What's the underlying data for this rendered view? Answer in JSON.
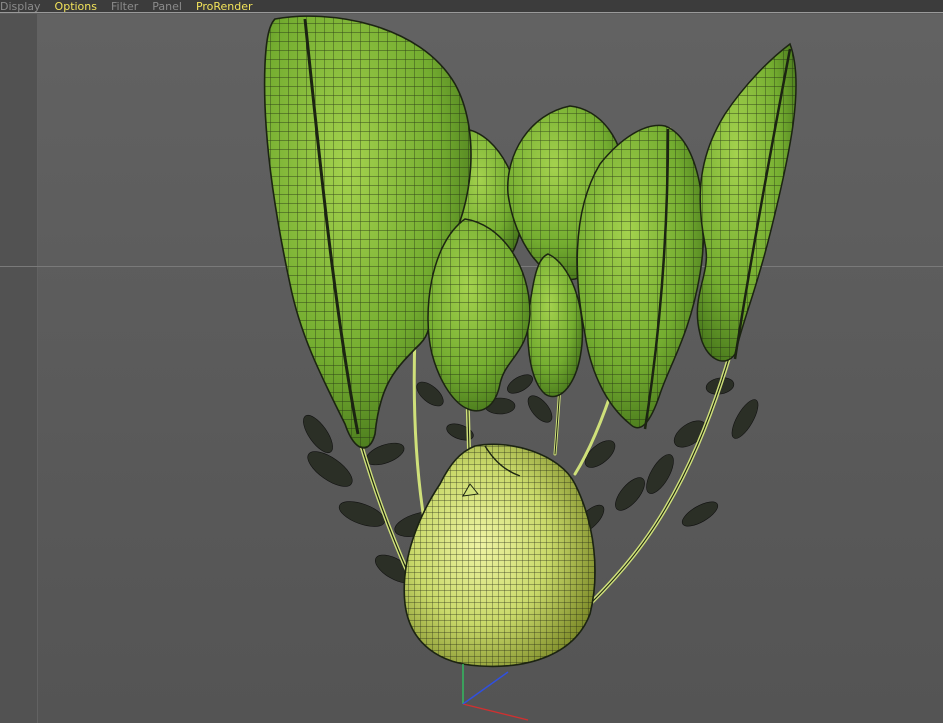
{
  "menu": {
    "items": [
      {
        "label": "Display",
        "state": "dim"
      },
      {
        "label": "Options",
        "state": "highlight"
      },
      {
        "label": "Filter",
        "state": "dim"
      },
      {
        "label": "Panel",
        "state": "dim"
      },
      {
        "label": "ProRender",
        "state": "highlight"
      }
    ]
  },
  "viewport": {
    "display_mode": "shaded-wireframe",
    "object": "kohlrabi-plant",
    "axis_colors": {
      "x": "#d03030",
      "y": "#30c060",
      "z": "#3050e0"
    }
  },
  "colors": {
    "menubar_bg": "#3c3c3c",
    "highlight_text": "#f2e35a",
    "dim_text": "#8b8b8b",
    "leaf_green": "#7fb73a",
    "bulb_yellow": "#d6e37d",
    "wire": "#1f2a12"
  }
}
